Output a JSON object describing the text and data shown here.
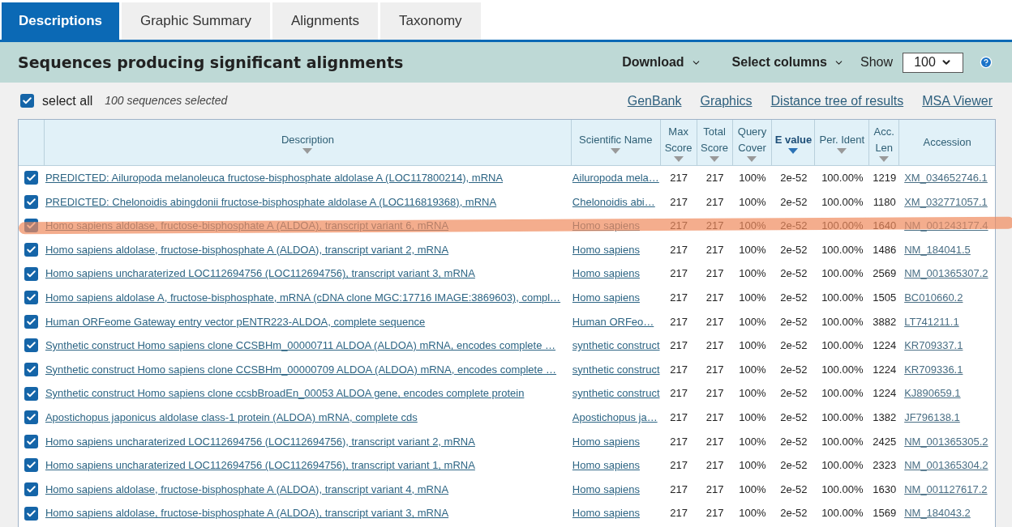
{
  "tabs": [
    {
      "label": "Descriptions",
      "selected": true
    },
    {
      "label": "Graphic Summary",
      "selected": false
    },
    {
      "label": "Alignments",
      "selected": false
    },
    {
      "label": "Taxonomy",
      "selected": false
    }
  ],
  "toolbar": {
    "title": "Sequences producing significant alignments",
    "download": "Download",
    "select_columns": "Select columns",
    "show_label": "Show",
    "show_value": "100"
  },
  "selection": {
    "select_all": "select all",
    "checked": true,
    "count": "100 sequences selected"
  },
  "links": [
    "GenBank",
    "Graphics",
    "Distance tree of results",
    "MSA Viewer"
  ],
  "table": {
    "columns": [
      {
        "label": "Description",
        "sortable": true,
        "sorted": false
      },
      {
        "label": "Scientific Name",
        "sortable": true,
        "sorted": false
      },
      {
        "label": "Max Score",
        "sortable": true,
        "sorted": false
      },
      {
        "label": "Total Score",
        "sortable": true,
        "sorted": false
      },
      {
        "label": "Query Cover",
        "sortable": true,
        "sorted": false
      },
      {
        "label": "E value",
        "sortable": true,
        "sorted": true
      },
      {
        "label": "Per. Ident",
        "sortable": true,
        "sorted": false
      },
      {
        "label": "Acc. Len",
        "sortable": true,
        "sorted": false
      },
      {
        "label": "Accession",
        "sortable": false,
        "sorted": false
      }
    ],
    "rows": [
      {
        "checked": true,
        "highlighted": false,
        "cells": [
          "PREDICTED: Ailuropoda melanoleuca fructose-bisphosphate aldolase A (LOC117800214), mRNA",
          "Ailuropoda mela…",
          "217",
          "217",
          "100%",
          "2e-52",
          "100.00%",
          "1219",
          "XM_034652746.1"
        ]
      },
      {
        "checked": true,
        "highlighted": false,
        "cells": [
          "PREDICTED: Chelonoidis abingdonii fructose-bisphosphate aldolase A (LOC116819368), mRNA",
          "Chelonoidis abi…",
          "217",
          "217",
          "100%",
          "2e-52",
          "100.00%",
          "1180",
          "XM_032771057.1"
        ]
      },
      {
        "checked": true,
        "highlighted": true,
        "cells": [
          "Homo sapiens aldolase, fructose-bisphosphate A (ALDOA), transcript variant 6, mRNA",
          "Homo sapiens",
          "217",
          "217",
          "100%",
          "2e-52",
          "100.00%",
          "1640",
          "NM_001243177.4"
        ]
      },
      {
        "checked": true,
        "highlighted": false,
        "cells": [
          "Homo sapiens aldolase, fructose-bisphosphate A (ALDOA), transcript variant 2, mRNA",
          "Homo sapiens",
          "217",
          "217",
          "100%",
          "2e-52",
          "100.00%",
          "1486",
          "NM_184041.5"
        ]
      },
      {
        "checked": true,
        "highlighted": false,
        "cells": [
          "Homo sapiens uncharaterized LOC112694756 (LOC112694756), transcript variant 3, mRNA",
          "Homo sapiens",
          "217",
          "217",
          "100%",
          "2e-52",
          "100.00%",
          "2569",
          "NM_001365307.2"
        ]
      },
      {
        "checked": true,
        "highlighted": false,
        "cells": [
          "Homo sapiens aldolase A, fructose-bisphosphate, mRNA (cDNA clone MGC:17716 IMAGE:3869603), compl…",
          "Homo sapiens",
          "217",
          "217",
          "100%",
          "2e-52",
          "100.00%",
          "1505",
          "BC010660.2"
        ]
      },
      {
        "checked": true,
        "highlighted": false,
        "cells": [
          "Human ORFeome Gateway entry vector pENTR223-ALDOA, complete sequence",
          "Human ORFeo…",
          "217",
          "217",
          "100%",
          "2e-52",
          "100.00%",
          "3882",
          "LT741211.1"
        ]
      },
      {
        "checked": true,
        "highlighted": false,
        "cells": [
          "Synthetic construct Homo sapiens clone CCSBHm_00000711 ALDOA (ALDOA) mRNA, encodes complete …",
          "synthetic construct",
          "217",
          "217",
          "100%",
          "2e-52",
          "100.00%",
          "1224",
          "KR709337.1"
        ]
      },
      {
        "checked": true,
        "highlighted": false,
        "cells": [
          "Synthetic construct Homo sapiens clone CCSBHm_00000709 ALDOA (ALDOA) mRNA, encodes complete …",
          "synthetic construct",
          "217",
          "217",
          "100%",
          "2e-52",
          "100.00%",
          "1224",
          "KR709336.1"
        ]
      },
      {
        "checked": true,
        "highlighted": false,
        "cells": [
          "Synthetic construct Homo sapiens clone ccsbBroadEn_00053 ALDOA gene, encodes complete protein",
          "synthetic construct",
          "217",
          "217",
          "100%",
          "2e-52",
          "100.00%",
          "1224",
          "KJ890659.1"
        ]
      },
      {
        "checked": true,
        "highlighted": false,
        "cells": [
          "Apostichopus japonicus aldolase class-1 protein (ALDOA) mRNA, complete cds",
          "Apostichopus ja…",
          "217",
          "217",
          "100%",
          "2e-52",
          "100.00%",
          "1382",
          "JF796138.1"
        ]
      },
      {
        "checked": true,
        "highlighted": false,
        "cells": [
          "Homo sapiens uncharaterized LOC112694756 (LOC112694756), transcript variant 2, mRNA",
          "Homo sapiens",
          "217",
          "217",
          "100%",
          "2e-52",
          "100.00%",
          "2425",
          "NM_001365305.2"
        ]
      },
      {
        "checked": true,
        "highlighted": false,
        "cells": [
          "Homo sapiens uncharaterized LOC112694756 (LOC112694756), transcript variant 1, mRNA",
          "Homo sapiens",
          "217",
          "217",
          "100%",
          "2e-52",
          "100.00%",
          "2323",
          "NM_001365304.2"
        ]
      },
      {
        "checked": true,
        "highlighted": false,
        "cells": [
          "Homo sapiens aldolase, fructose-bisphosphate A (ALDOA), transcript variant 4, mRNA",
          "Homo sapiens",
          "217",
          "217",
          "100%",
          "2e-52",
          "100.00%",
          "1630",
          "NM_001127617.2"
        ]
      },
      {
        "checked": true,
        "highlighted": false,
        "cells": [
          "Homo sapiens aldolase, fructose-bisphosphate A (ALDOA), transcript variant 3, mRNA",
          "Homo sapiens",
          "217",
          "217",
          "100%",
          "2e-52",
          "100.00%",
          "1569",
          "NM_184043.2"
        ]
      }
    ]
  }
}
